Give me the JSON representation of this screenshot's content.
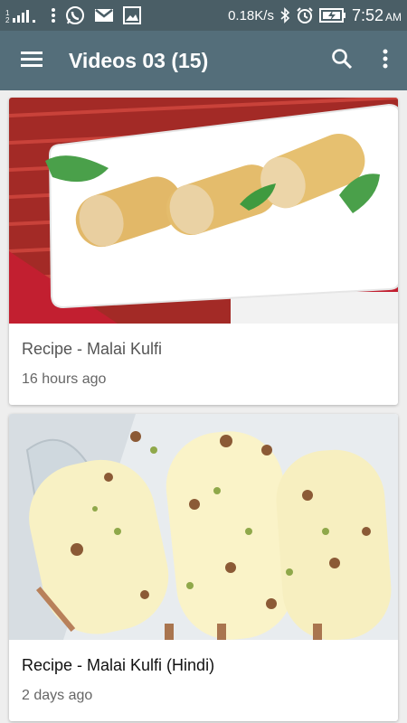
{
  "status": {
    "speed": "0.18K/s",
    "time": "7:52",
    "ampm": "AM",
    "icons": [
      "sim-signal-icon",
      "more-dots-icon",
      "whatsapp-icon",
      "gmail-icon",
      "gallery-icon",
      "bluetooth-icon",
      "alarm-icon",
      "battery-charging-icon"
    ]
  },
  "appbar": {
    "title": "Videos 03 (15)",
    "icons": [
      "menu-icon",
      "search-icon",
      "overflow-menu-icon"
    ]
  },
  "videos": [
    {
      "title": "Recipe - Malai Kulfi",
      "meta": "16 hours ago"
    },
    {
      "title": "Recipe - Malai Kulfi (Hindi)",
      "meta": "2 days ago"
    }
  ],
  "colors": {
    "statusbar": "#4a5e66",
    "appbar": "#546e7a",
    "background": "#eeeeee"
  }
}
